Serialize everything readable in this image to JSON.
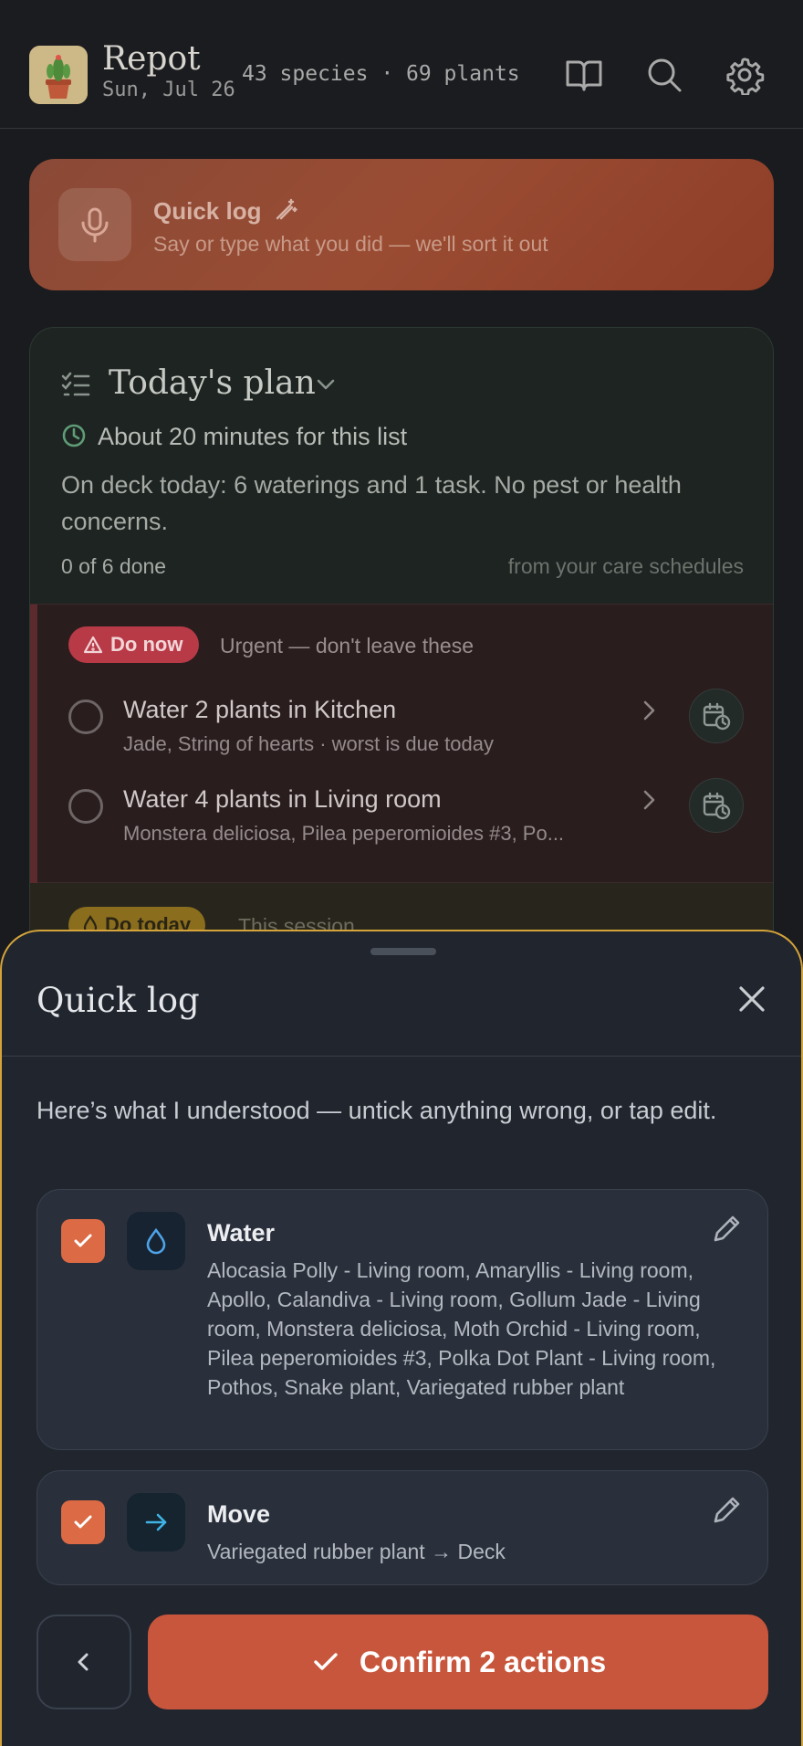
{
  "header": {
    "app_name": "Repot",
    "date": "Sun, Jul 26",
    "stats": "43 species · 69 plants",
    "icons": [
      "book-icon",
      "search-icon",
      "gear-icon"
    ]
  },
  "quick_log_banner": {
    "title": "Quick log",
    "subtitle": "Say or type what you did — we'll sort it out"
  },
  "plan": {
    "title": "Today's plan",
    "time_estimate": "About 20 minutes for this list",
    "summary": "On deck today: 6 waterings and 1 task. No pest or health concerns.",
    "progress": "0 of 6 done",
    "source": "from your care schedules",
    "urgent": {
      "badge": "Do now",
      "note": "Urgent — don't leave these",
      "tasks": [
        {
          "title": "Water 2 plants in Kitchen",
          "subtitle": "Jade, String of hearts · worst is due today"
        },
        {
          "title": "Water 4 plants in Living room",
          "subtitle": "Monstera deliciosa, Pilea peperomioides #3, Po..."
        }
      ]
    },
    "today": {
      "badge": "Do today",
      "note": "This session"
    }
  },
  "sheet": {
    "title": "Quick log",
    "intro": "Here’s what I understood — untick anything wrong, or tap edit.",
    "actions": [
      {
        "title": "Water",
        "description": "Alocasia Polly - Living room, Amaryllis - Living room, Apollo, Calandiva - Living room, Gollum Jade - Living room, Monstera deliciosa, Moth Orchid - Living room, Pilea peperomioides #3, Polka Dot Plant - Living room, Pothos, Snake plant, Variegated rubber plant",
        "checked": true,
        "icon": "water-drop-icon"
      },
      {
        "title": "Move",
        "description": "Variegated rubber plant → Deck",
        "checked": true,
        "icon": "arrow-right-icon"
      }
    ],
    "confirm_label": "Confirm 2 actions"
  },
  "colors": {
    "accent": "#c8563c",
    "checkbox": "#dc6a44",
    "sheet_border": "#d4a43a",
    "urgent_badge": "#b83a47",
    "today_badge": "#8a6d1d"
  }
}
